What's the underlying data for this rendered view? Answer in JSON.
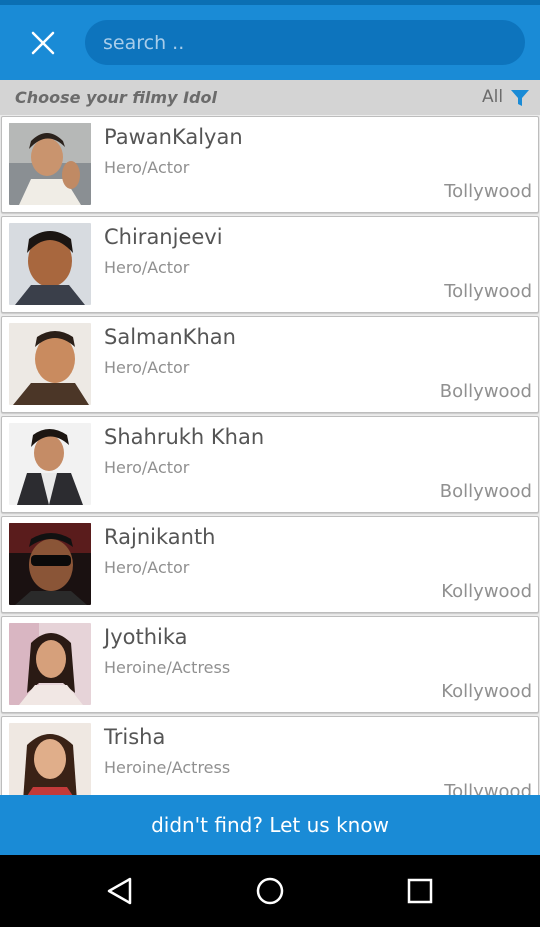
{
  "search": {
    "placeholder": "search .."
  },
  "filter": {
    "prompt": "Choose your filmy Idol",
    "selected": "All"
  },
  "idols": [
    {
      "name": "PawanKalyan",
      "role": "Hero/Actor",
      "industry": "Tollywood"
    },
    {
      "name": "Chiranjeevi",
      "role": "Hero/Actor",
      "industry": "Tollywood"
    },
    {
      "name": "SalmanKhan",
      "role": "Hero/Actor",
      "industry": "Bollywood"
    },
    {
      "name": "Shahrukh Khan",
      "role": "Hero/Actor",
      "industry": "Bollywood"
    },
    {
      "name": "Rajnikanth",
      "role": "Hero/Actor",
      "industry": "Kollywood"
    },
    {
      "name": "Jyothika",
      "role": "Heroine/Actress",
      "industry": "Kollywood"
    },
    {
      "name": "Trisha",
      "role": "Heroine/Actress",
      "industry": "Tollywood"
    }
  ],
  "cta": {
    "label": "didn't find? Let us know"
  },
  "icons": {
    "close": "close-icon",
    "filter": "filter-icon",
    "back": "back-icon",
    "home": "home-icon",
    "recents": "recents-icon"
  },
  "colors": {
    "accent": "#1a8bd6",
    "accent_dark": "#0d74bd"
  }
}
